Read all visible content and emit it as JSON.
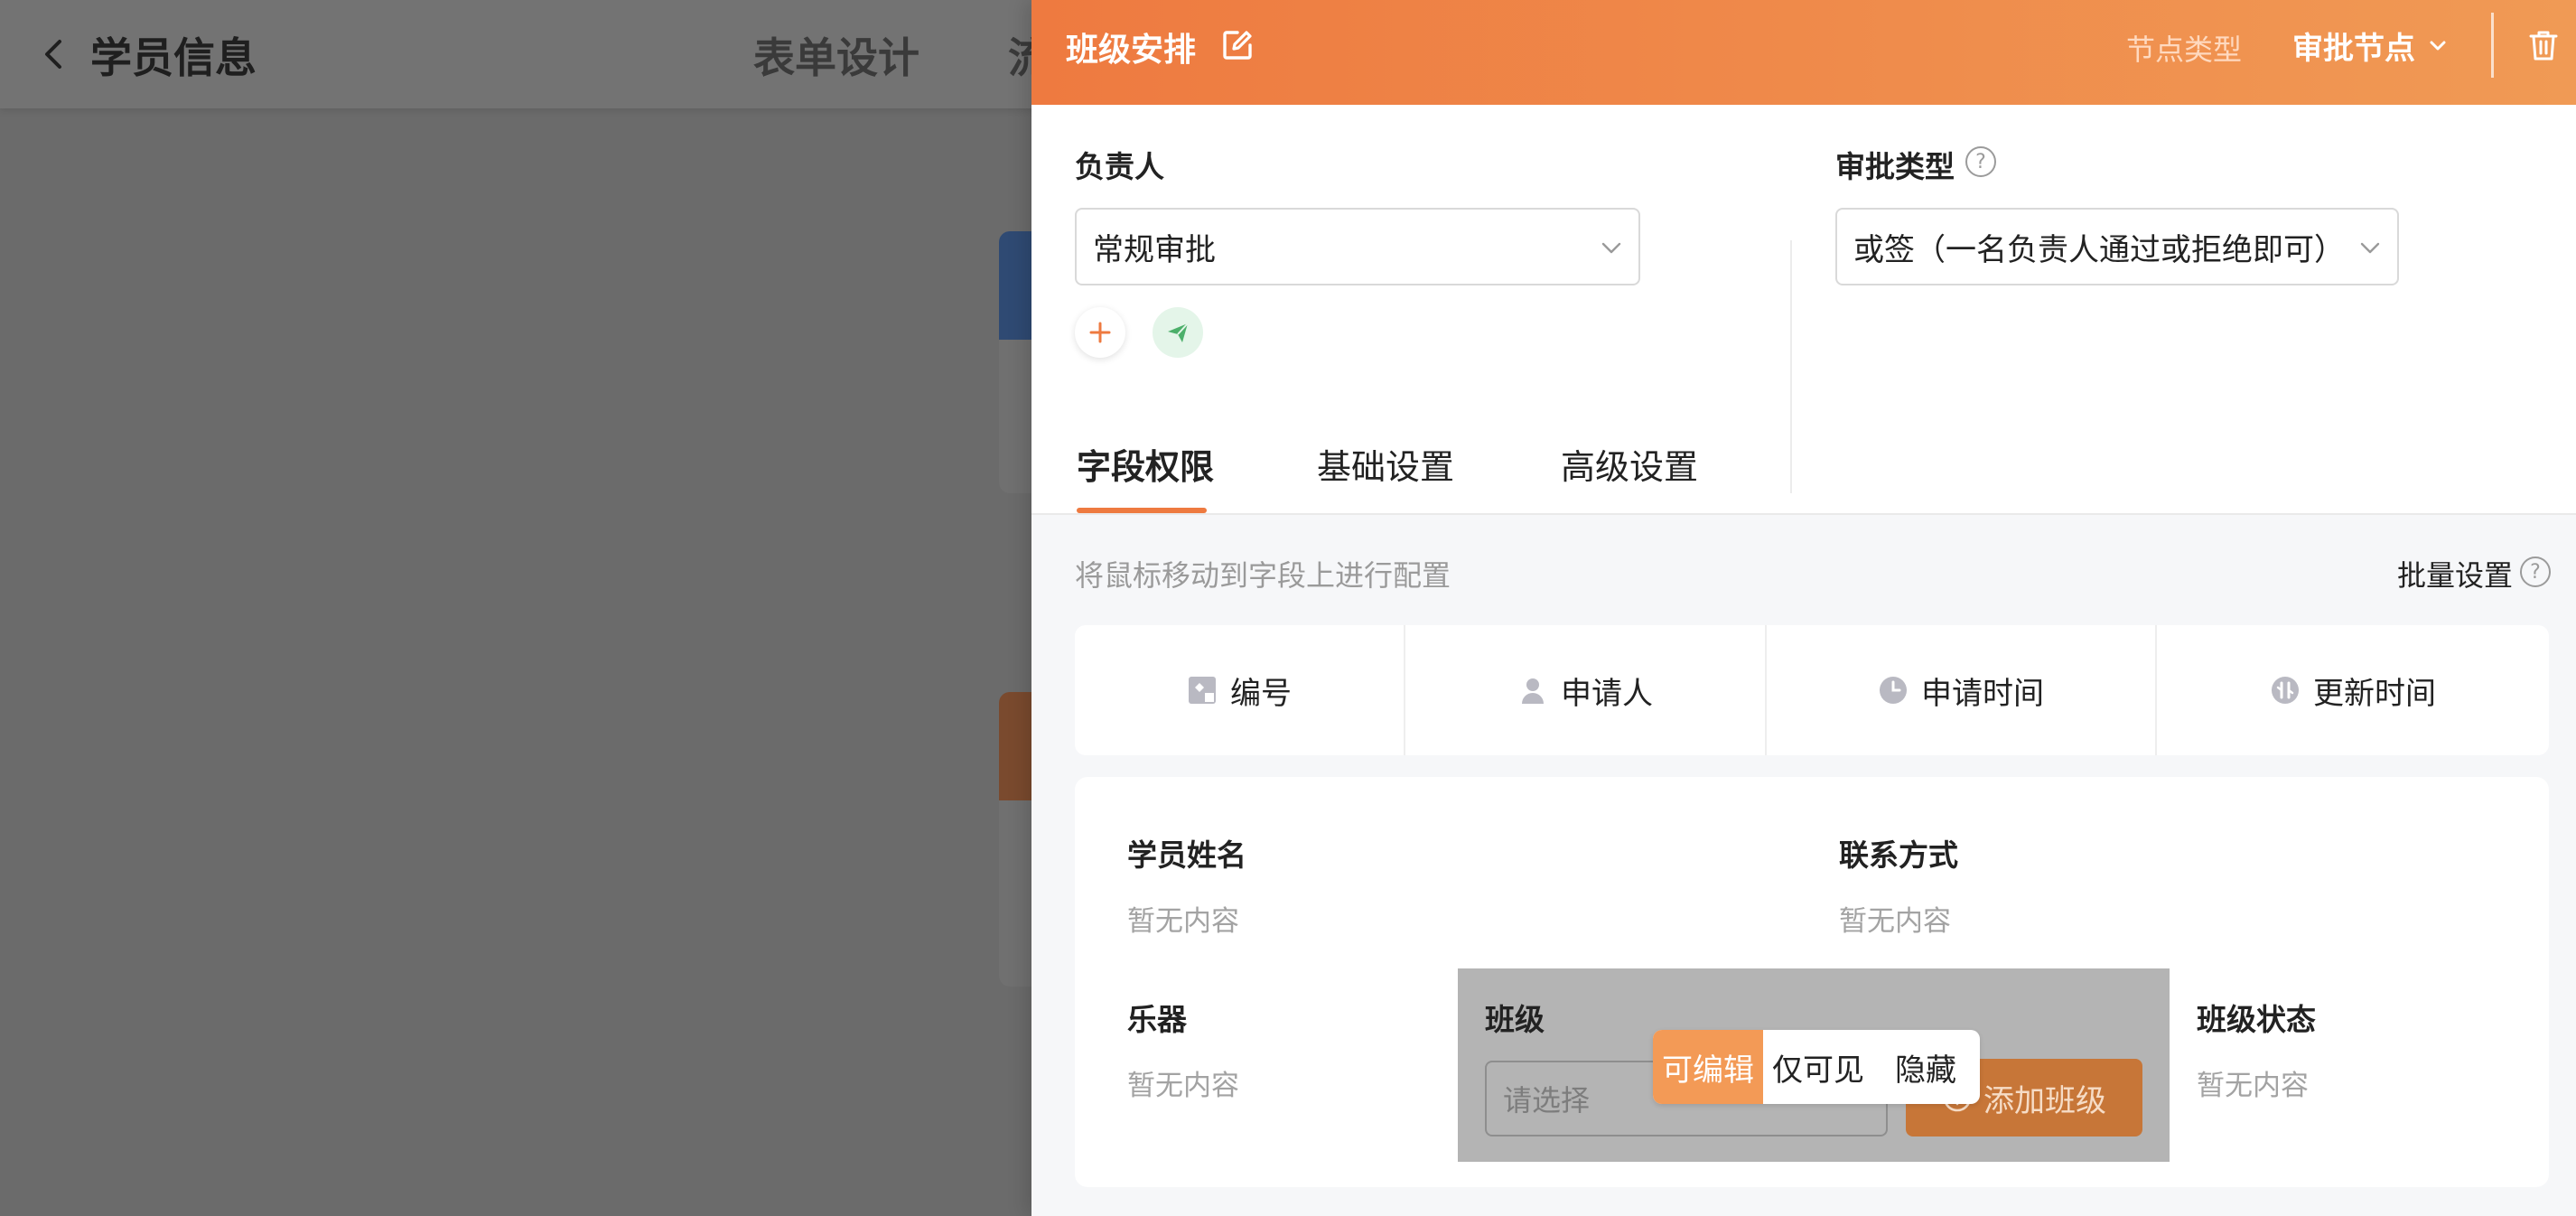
{
  "background": {
    "back_icon": "chevron-left-icon",
    "title": "学员信息",
    "tabs": [
      "表单设计",
      "流"
    ]
  },
  "drawer": {
    "title": "班级安排",
    "edit_icon": "edit-icon",
    "node_type_label": "节点类型",
    "node_type_value": "审批节点",
    "trash_icon": "trash-icon",
    "assignee": {
      "label": "负责人",
      "value": "常规审批"
    },
    "approval_type": {
      "label": "审批类型",
      "value": "或签（一名负责人通过或拒绝即可）"
    },
    "tabs": [
      {
        "label": "字段权限",
        "active": true
      },
      {
        "label": "基础设置",
        "active": false
      },
      {
        "label": "高级设置",
        "active": false
      }
    ],
    "hint": "将鼠标移动到字段上进行配置",
    "batch_label": "批量设置",
    "system_fields": [
      {
        "label": "编号",
        "icon": "id-card-icon"
      },
      {
        "label": "申请人",
        "icon": "person-icon"
      },
      {
        "label": "申请时间",
        "icon": "clock-icon"
      },
      {
        "label": "更新时间",
        "icon": "refresh-time-icon"
      }
    ],
    "form_fields": {
      "student_name": {
        "label": "学员姓名",
        "value": "暂无内容"
      },
      "contact": {
        "label": "联系方式",
        "value": "暂无内容"
      },
      "instrument": {
        "label": "乐器",
        "value": "暂无内容"
      },
      "class": {
        "label": "班级",
        "placeholder": "请选择",
        "add_label": "添加班级"
      },
      "class_status": {
        "label": "班级状态",
        "value": "暂无内容"
      }
    },
    "permission_options": [
      {
        "label": "可编辑",
        "active": true
      },
      {
        "label": "仅可见",
        "active": false
      },
      {
        "label": "隐藏",
        "active": false
      }
    ],
    "colors": {
      "accent": "#ee7a40",
      "accent_light": "#f09a55",
      "send_green": "#4caf6a"
    }
  }
}
